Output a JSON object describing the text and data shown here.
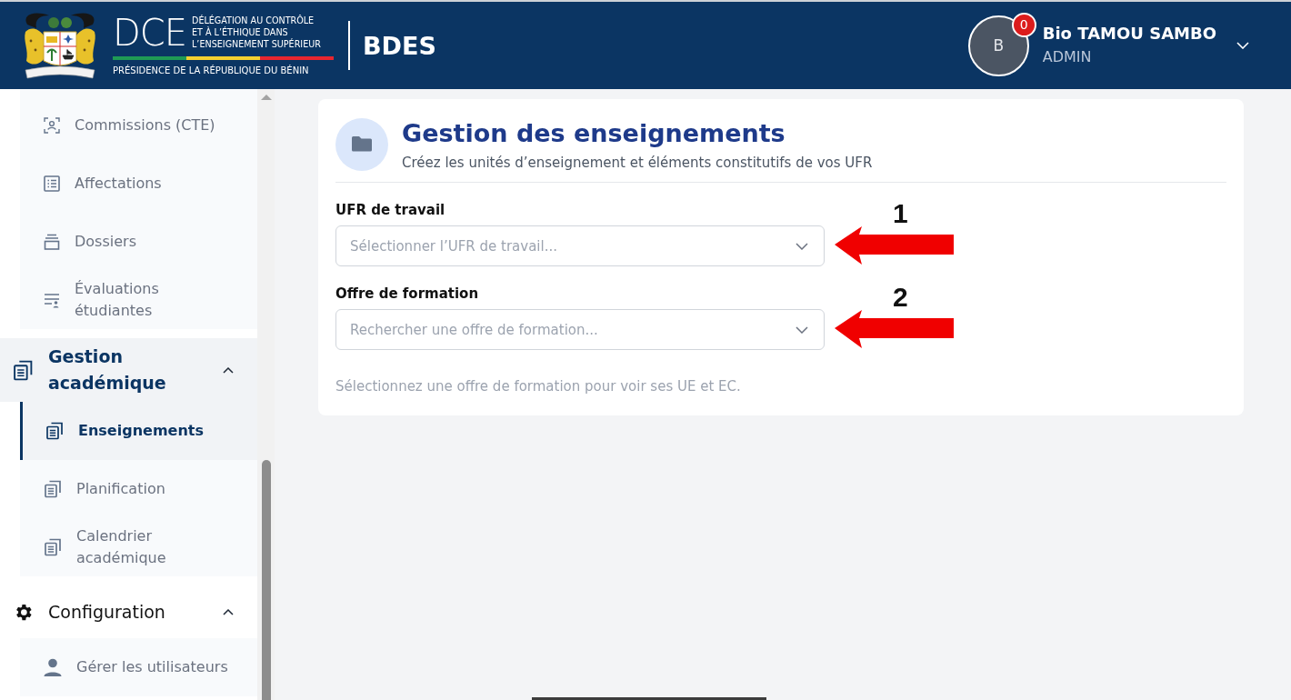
{
  "header": {
    "logo": {
      "acronym": "DCE",
      "lines": [
        "DÉLÉGATION AU CONTRÔLE",
        "ET À L’ÉTHIQUE DANS",
        "L’ENSEIGNEMENT SUPÉRIEUR"
      ],
      "subtitle": "PRÉSIDENCE DE LA RÉPUBLIQUE DU BÉNIN"
    },
    "app_name": "BDES",
    "user": {
      "initial": "B",
      "notifications": "0",
      "name": "Bio TAMOU SAMBO",
      "role": "ADMIN"
    }
  },
  "sidebar": {
    "sections": [
      {
        "children": [
          {
            "label": "Commissions (CTE)",
            "selected": false
          },
          {
            "label": "Affectations",
            "selected": false
          },
          {
            "label": "Dossiers",
            "selected": false
          },
          {
            "label": "Évaluations étudiantes",
            "selected": false
          }
        ]
      },
      {
        "label": "Gestion académique",
        "active": true,
        "expanded": true,
        "children": [
          {
            "label": "Enseignements",
            "selected": true
          },
          {
            "label": "Planification",
            "selected": false
          },
          {
            "label": "Calendrier académique",
            "selected": false
          }
        ]
      },
      {
        "label": "Configuration",
        "active": false,
        "expanded": true,
        "children": [
          {
            "label": "Gérer les utilisateurs",
            "selected": false
          }
        ]
      }
    ]
  },
  "page": {
    "title": "Gestion des enseignements",
    "subtitle": "Créez les unités d’enseignement et éléments constitutifs de vos UFR",
    "fields": [
      {
        "label": "UFR de travail",
        "placeholder": "Sélectionner l’UFR de travail...",
        "annotation": "1"
      },
      {
        "label": "Offre de formation",
        "placeholder": "Rechercher une offre de formation...",
        "annotation": "2"
      }
    ],
    "hint": "Sélectionnez une offre de formation pour voir ses UE et EC."
  }
}
